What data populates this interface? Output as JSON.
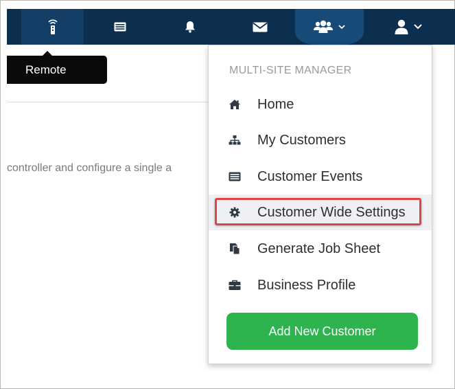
{
  "tooltip": {
    "label": "Remote"
  },
  "page": {
    "body_text": "controller and configure a single a"
  },
  "navbar": {
    "icons": [
      "remote-icon",
      "events-icon",
      "bell-icon",
      "mail-icon",
      "users-icon",
      "user-icon"
    ],
    "colors": {
      "bar": "#0d2f4f",
      "active": "#133f66",
      "open": "#174a77"
    }
  },
  "dropdown": {
    "header": "MULTI-SITE MANAGER",
    "items": [
      {
        "label": "Home",
        "icon": "home-icon"
      },
      {
        "label": "My Customers",
        "icon": "sitemap-icon"
      },
      {
        "label": "Customer Events",
        "icon": "list-icon"
      },
      {
        "label": "Customer Wide Settings",
        "icon": "gear-icon"
      },
      {
        "label": "Generate Job Sheet",
        "icon": "copy-icon"
      },
      {
        "label": "Business Profile",
        "icon": "briefcase-icon"
      }
    ],
    "button_label": "Add New Customer",
    "highlight_color": "#e0424a",
    "button_color": "#2db44f"
  }
}
